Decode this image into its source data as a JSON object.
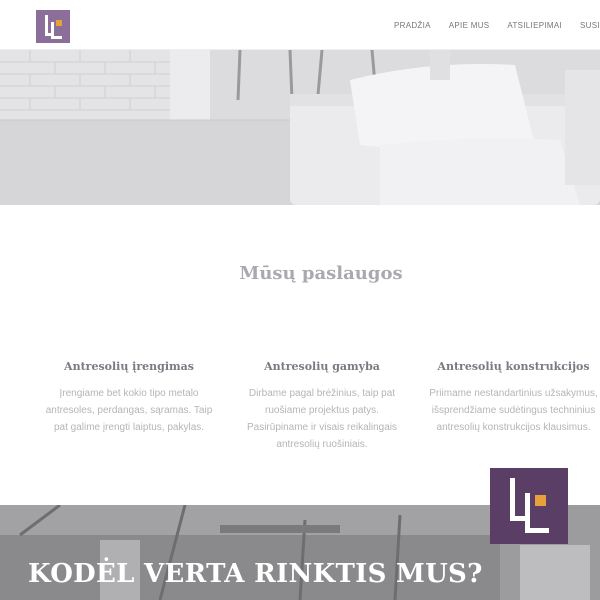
{
  "nav": {
    "items": [
      {
        "label": "PRADŽIA"
      },
      {
        "label": "APIE MUS"
      },
      {
        "label": "ATSILIEPIMAI"
      },
      {
        "label": "SUSISIEKTI"
      }
    ]
  },
  "brand": {
    "logo_icon": "lt-monogram-logo",
    "logo_color": "#8b6f9a",
    "accent_color": "#e6a13a",
    "float_logo_color": "#5b3e66"
  },
  "services": {
    "title": "Mūsų paslaugos",
    "items": [
      {
        "title": "Antresolių įrengimas",
        "text": "Įrengiame bet kokio tipo metalo antresoles, perdangas, sąramas. Taip pat galime įrengti laiptus, pakylas."
      },
      {
        "title": "Antresolių gamyba",
        "text": "Dirbame pagal brėžinius, taip pat ruošiame projektus patys. Pasirūpiname ir visais reikalingais antresolių ruošiniais."
      },
      {
        "title": "Antresolių konstrukcijos",
        "text": "Priimame nestandartinius užsakymus, išsprendžiame sudėtingus techninius antresolių konstrukcijos klausimus."
      }
    ]
  },
  "banner": {
    "title": "KODĖL VERTA RINKTIS MUS?"
  }
}
